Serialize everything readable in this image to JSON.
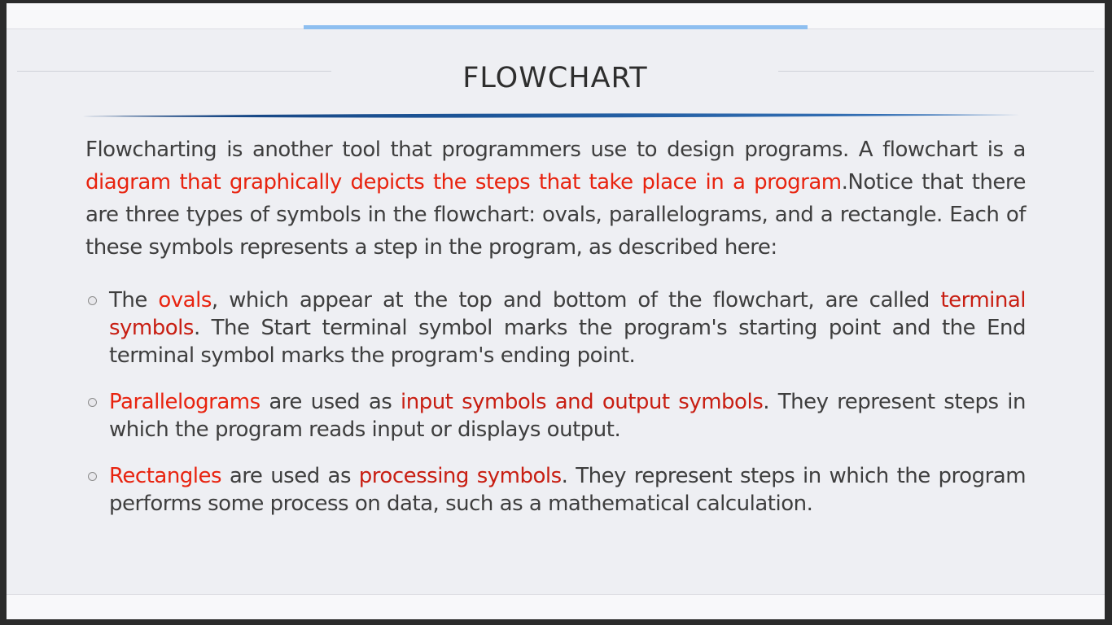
{
  "slide": {
    "title": "FLOWCHART",
    "intro": {
      "text1": "Flowcharting is another tool that programmers use to design programs. A flowchart is a ",
      "highlight1": "diagram that graphically depicts the steps that take place in a program",
      "text2": ".Notice that there are three types of symbols in the flowchart: ovals, parallelograms, and a rectangle. Each of these symbols represents a step in the program, as described here:"
    },
    "bullets": [
      {
        "p1": "The ",
        "h1": "ovals",
        "p2": ", which appear at the top and bottom of the flowchart, are called ",
        "h2": "terminal symbols",
        "p3": ". The Start terminal symbol marks the program's starting point and the End terminal symbol marks the program's ending point."
      },
      {
        "p1": "",
        "h1": "Parallelograms",
        "p2": " are used as ",
        "h2": "input symbols and output symbols",
        "p3": ". They represent steps in which the program reads input or displays output."
      },
      {
        "p1": "",
        "h1": "Rectangles",
        "p2": " are used as ",
        "h2": "processing symbols",
        "p3": ". They represent steps in which the program performs some process on data, such as a mathematical calculation."
      }
    ]
  },
  "colors": {
    "highlight": "#e8230f",
    "highlight_dark": "#c81e12",
    "body_text": "#3e3e3e",
    "title_underline": "#1f4f8f",
    "top_accent": "#8ebff0"
  },
  "icons": {
    "bullet": "hollow-circle-bullet-icon"
  }
}
